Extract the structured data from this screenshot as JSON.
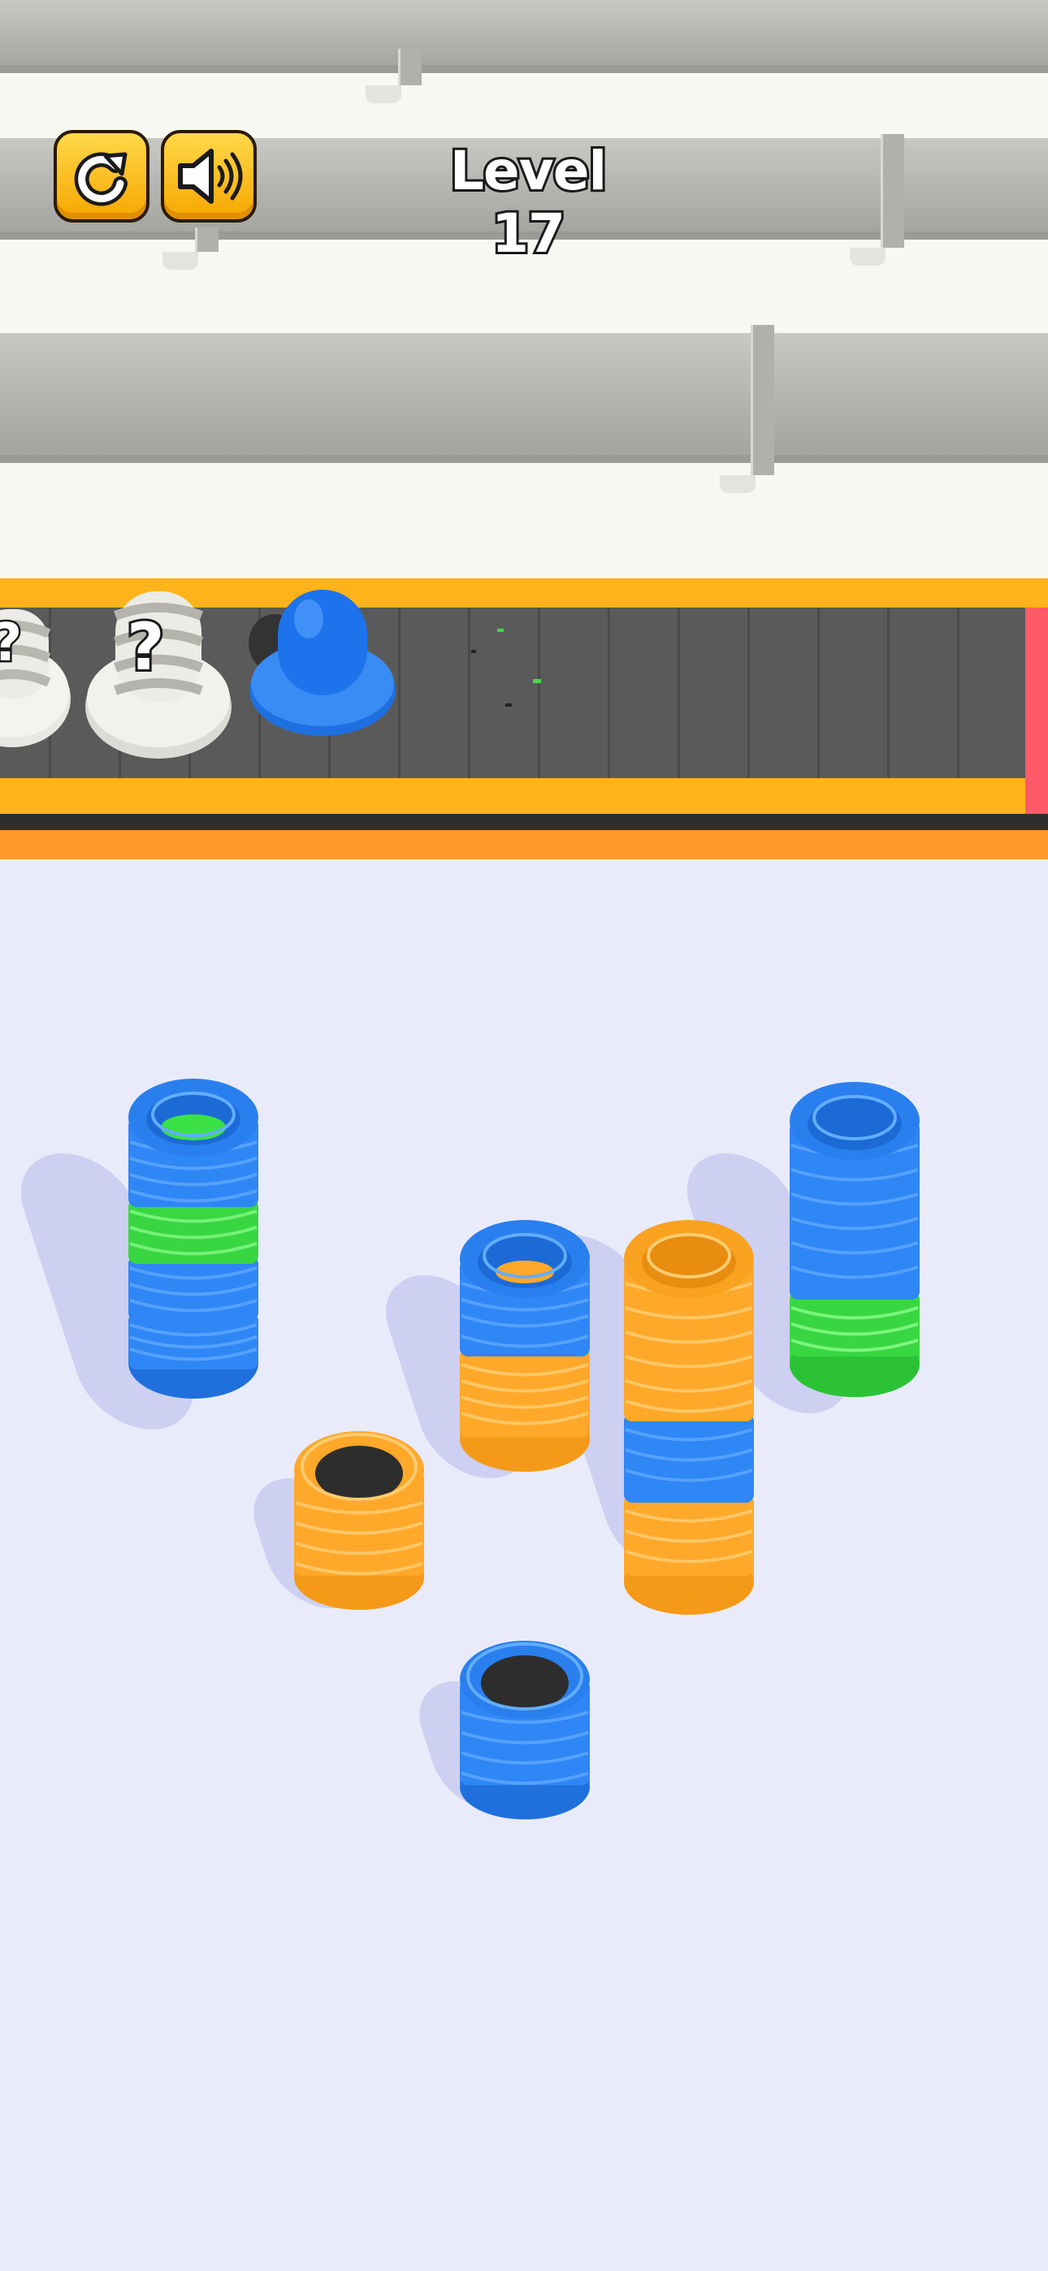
{
  "hud": {
    "level_label": "Level 17",
    "restart_icon": "restart-icon",
    "sound_icon": "sound-icon"
  },
  "conveyor": {
    "items": [
      {
        "type": "mystery-stack",
        "label": "?"
      },
      {
        "type": "mystery-stack",
        "label": "?"
      },
      {
        "type": "blue-peg",
        "label": ""
      }
    ]
  },
  "colors": {
    "blue": "#2f86f5",
    "green": "#3be046",
    "orange": "#ffa82a",
    "hole": "#2d2d2d",
    "button": "#ffc61a",
    "conveyor_frame": "#ffb31a",
    "belt": "#5a5a5a",
    "background": "#e9ebfa"
  },
  "stacks": [
    {
      "name": "stack-1",
      "rings_top_to_bottom": [
        "blue",
        "green",
        "blue"
      ],
      "state": "full"
    },
    {
      "name": "stack-2",
      "rings_top_to_bottom": [
        "blue",
        "orange"
      ],
      "state": "full"
    },
    {
      "name": "stack-3",
      "rings_top_to_bottom": [
        "orange",
        "blue",
        "orange"
      ],
      "state": "full"
    },
    {
      "name": "stack-4",
      "rings_top_to_bottom": [
        "blue",
        "green"
      ],
      "state": "full"
    },
    {
      "name": "stack-5",
      "rings_top_to_bottom": [
        "orange"
      ],
      "state": "open"
    },
    {
      "name": "stack-6",
      "rings_top_to_bottom": [
        "blue"
      ],
      "state": "open"
    }
  ]
}
